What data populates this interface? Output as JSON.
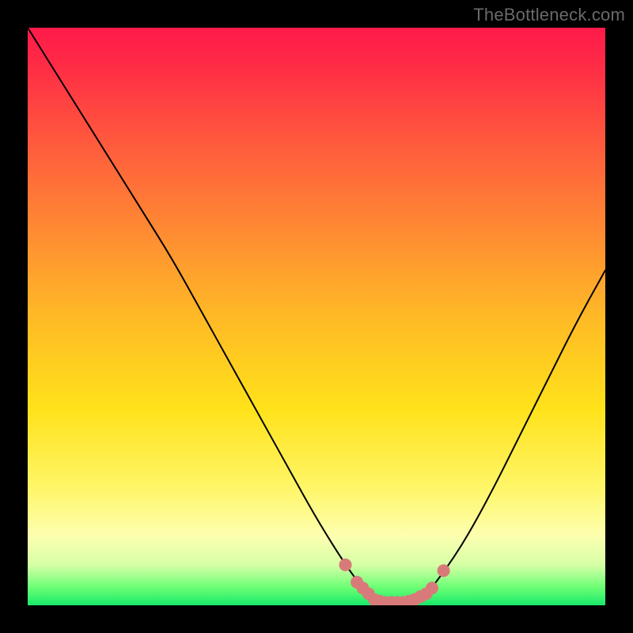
{
  "watermark": "TheBottleneck.com",
  "colors": {
    "background": "#000000",
    "gradient_top": "#ff1a4a",
    "gradient_bottom": "#18e86a",
    "curve": "#000000",
    "trough_marker": "#d97a7a"
  },
  "chart_data": {
    "type": "line",
    "title": "",
    "xlabel": "",
    "ylabel": "",
    "xlim": [
      0,
      100
    ],
    "ylim": [
      0,
      100
    ],
    "annotations": [],
    "series": [
      {
        "name": "bottleneck-curve",
        "x": [
          0,
          5,
          10,
          15,
          20,
          25,
          30,
          35,
          40,
          45,
          50,
          55,
          58,
          60,
          62,
          65,
          68,
          70,
          75,
          80,
          85,
          90,
          95,
          100
        ],
        "values": [
          100,
          92,
          84,
          76,
          68,
          60,
          51,
          42,
          33,
          24,
          15,
          7,
          3,
          1,
          0.5,
          0.5,
          1,
          3,
          10,
          19,
          29,
          39,
          49,
          58
        ]
      }
    ],
    "trough_marker": {
      "points": [
        {
          "x": 55,
          "y": 7
        },
        {
          "x": 57,
          "y": 4
        },
        {
          "x": 58,
          "y": 3
        },
        {
          "x": 59,
          "y": 2
        },
        {
          "x": 60,
          "y": 1
        },
        {
          "x": 61,
          "y": 0.7
        },
        {
          "x": 62,
          "y": 0.5
        },
        {
          "x": 63,
          "y": 0.5
        },
        {
          "x": 64,
          "y": 0.5
        },
        {
          "x": 65,
          "y": 0.5
        },
        {
          "x": 66,
          "y": 0.7
        },
        {
          "x": 67,
          "y": 1
        },
        {
          "x": 68,
          "y": 1.5
        },
        {
          "x": 69,
          "y": 2
        },
        {
          "x": 70,
          "y": 3
        },
        {
          "x": 72,
          "y": 6
        }
      ]
    }
  }
}
